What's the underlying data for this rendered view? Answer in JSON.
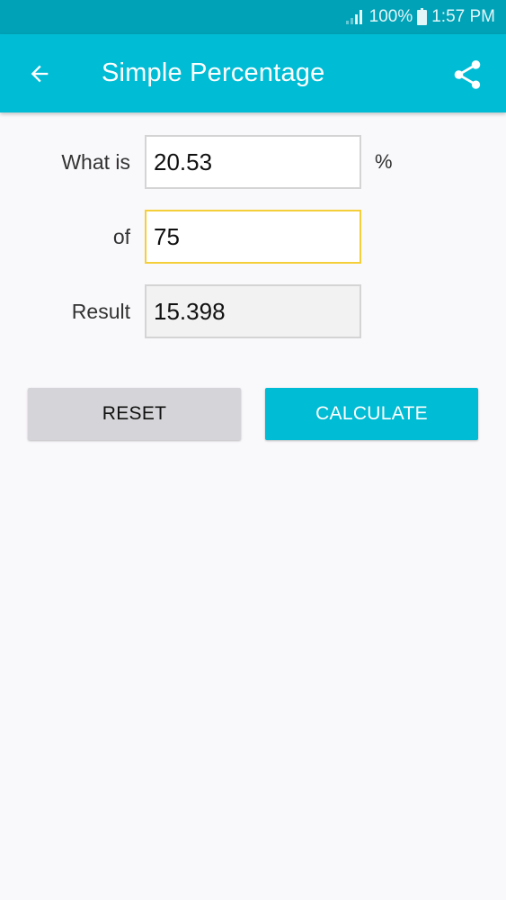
{
  "status_bar": {
    "battery_percent": "100%",
    "time": "1:57 PM",
    "background_color": "#00a2b7"
  },
  "app_bar": {
    "title": "Simple Percentage",
    "background_color": "#00bcd4",
    "back_icon": "arrow-left-icon",
    "share_icon": "share-icon"
  },
  "form": {
    "percent_row": {
      "label": "What is",
      "value": "20.53",
      "suffix": "%"
    },
    "of_row": {
      "label": "of",
      "value": "75"
    },
    "result_row": {
      "label": "Result",
      "value": "15.398"
    }
  },
  "buttons": {
    "reset_label": "RESET",
    "calculate_label": "CALCULATE"
  }
}
